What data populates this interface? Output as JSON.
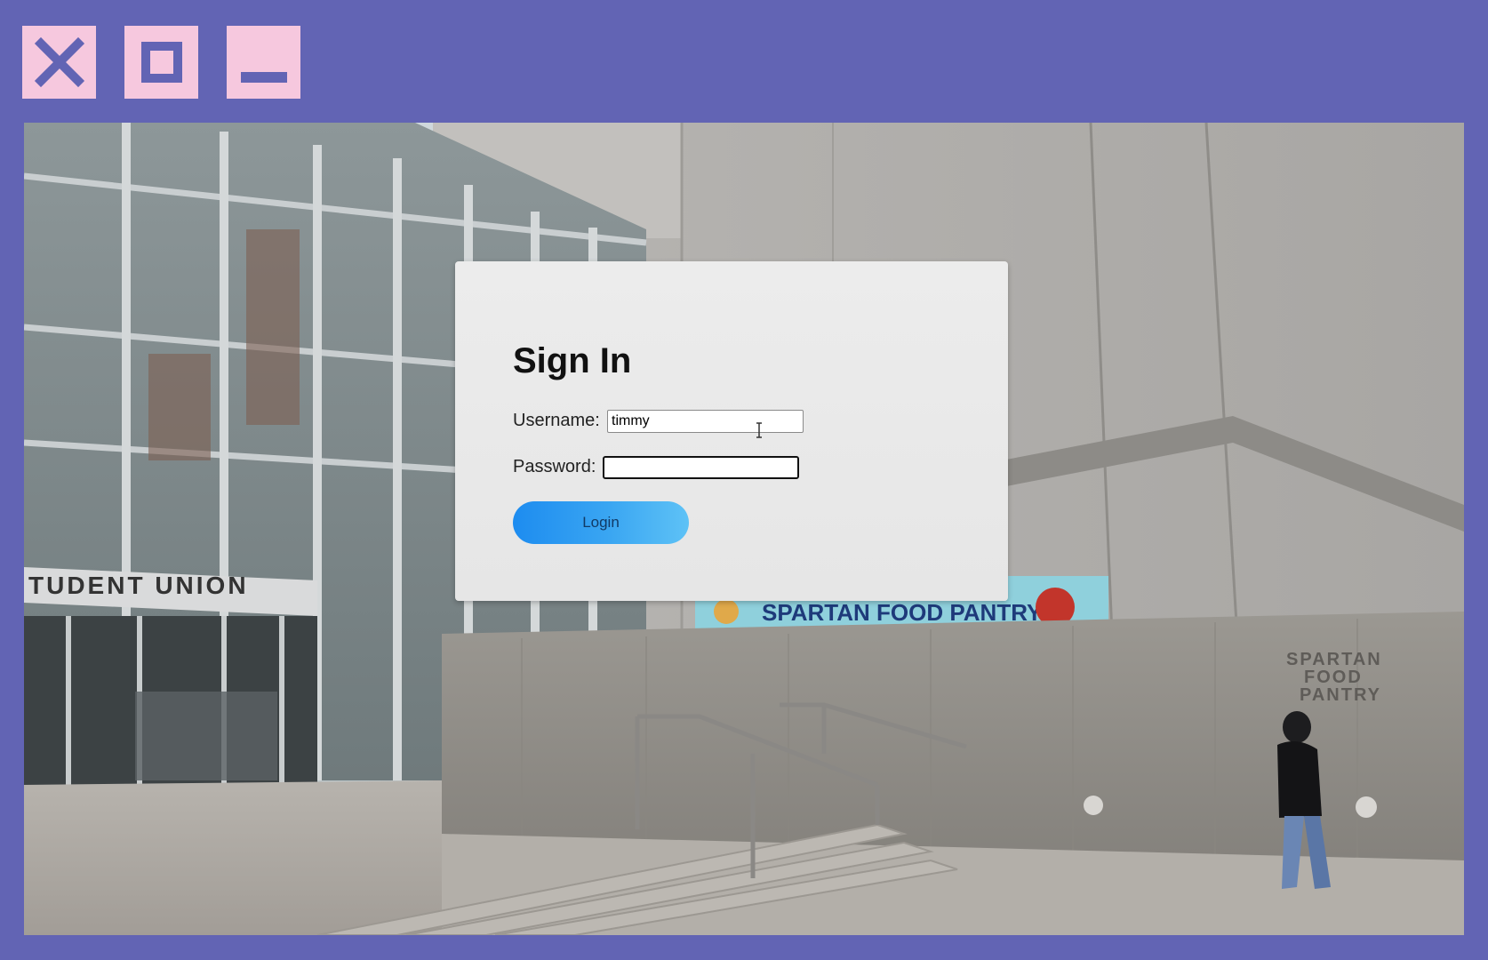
{
  "window_controls": {
    "close": "close-icon",
    "maximize": "maximize-icon",
    "minimize": "minimize-icon",
    "button_color": "#f6c8de",
    "icon_color": "#6264b4"
  },
  "frame_color": "#6264b4",
  "background_scene": {
    "building_sign": "TUDENT UNION",
    "banner_text": "SPARTAN FOOD PANTRY",
    "wall_sign": [
      "SPARTAN",
      "FOOD",
      "PANTRY"
    ]
  },
  "signin": {
    "title": "Sign In",
    "username_label": "Username:",
    "username_value": "timmy",
    "password_label": "Password:",
    "password_value": "",
    "login_label": "Login"
  }
}
